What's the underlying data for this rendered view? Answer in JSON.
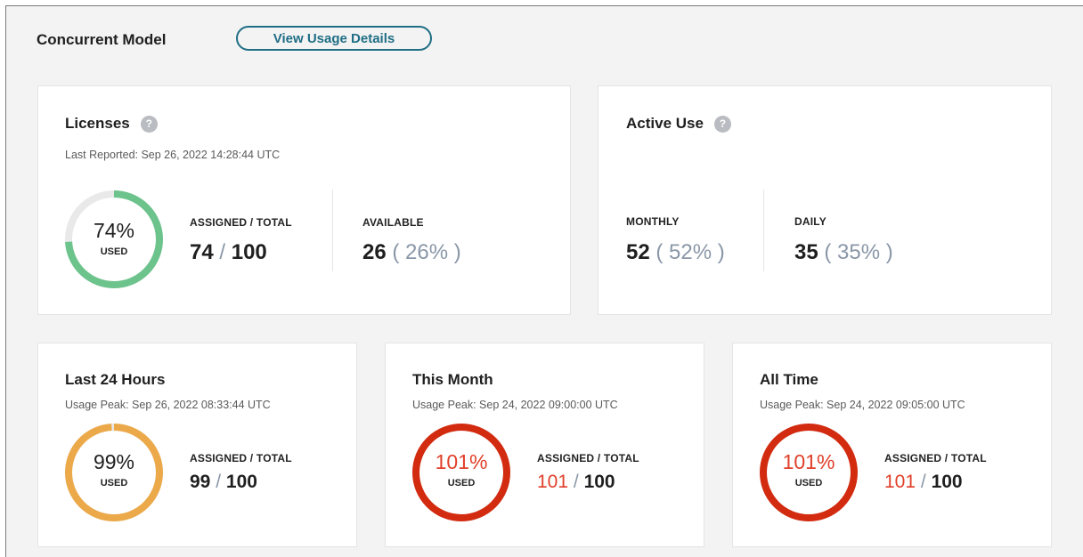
{
  "header": {
    "title": "Concurrent Model",
    "usage_button": "View Usage Details"
  },
  "licenses": {
    "title": "Licenses",
    "help": "?",
    "last_reported": "Last Reported: Sep 26, 2022 14:28:44 UTC",
    "ring": {
      "percent": "74%",
      "used": "USED",
      "fraction": 0.74,
      "color": "#6cc38b"
    },
    "assigned_label": "ASSIGNED / TOTAL",
    "assigned": "74",
    "total": "100",
    "available_label": "AVAILABLE",
    "available": "26",
    "available_pct": "( 26% )"
  },
  "active_use": {
    "title": "Active Use",
    "help": "?",
    "monthly_label": "MONTHLY",
    "monthly": "52",
    "monthly_pct": "( 52% )",
    "daily_label": "DAILY",
    "daily": "35",
    "daily_pct": "( 35% )"
  },
  "last24": {
    "title": "Last 24 Hours",
    "peak": "Usage Peak: Sep 26, 2022 08:33:44 UTC",
    "ring": {
      "percent": "99%",
      "used": "USED",
      "fraction": 0.99,
      "color": "#eba94a"
    },
    "assigned_label": "ASSIGNED / TOTAL",
    "assigned": "99",
    "total": "100"
  },
  "this_month": {
    "title": "This Month",
    "peak": "Usage Peak: Sep 24, 2022 09:00:00 UTC",
    "ring": {
      "percent": "101%",
      "used": "USED",
      "fraction": 1.0,
      "color": "#d22b10"
    },
    "assigned_label": "ASSIGNED / TOTAL",
    "assigned": "101",
    "total": "100"
  },
  "all_time": {
    "title": "All Time",
    "peak": "Usage Peak: Sep 24, 2022 09:05:00 UTC",
    "ring": {
      "percent": "101%",
      "used": "USED",
      "fraction": 1.0,
      "color": "#d22b10"
    },
    "assigned_label": "ASSIGNED / TOTAL",
    "assigned": "101",
    "total": "100"
  }
}
